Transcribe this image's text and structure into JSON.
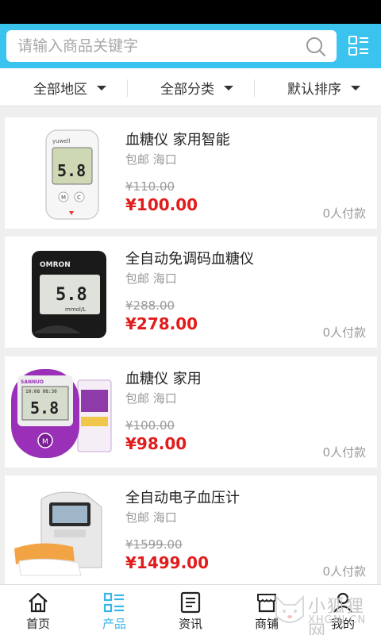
{
  "search": {
    "placeholder": "请输入商品关键字"
  },
  "filters": [
    {
      "label": "全部地区"
    },
    {
      "label": "全部分类"
    },
    {
      "label": "默认排序"
    }
  ],
  "products": [
    {
      "title": "血糖仪 家用智能",
      "shipping": "包邮 海口",
      "old_price": "¥110.00",
      "price": "¥100.00",
      "paid": "0人付款",
      "image": "glucose-meter-white"
    },
    {
      "title": "全自动免调码血糖仪",
      "shipping": "包邮 海口",
      "old_price": "¥288.00",
      "price": "¥278.00",
      "paid": "0人付款",
      "image": "glucose-meter-black-omron"
    },
    {
      "title": "血糖仪 家用",
      "shipping": "包邮 海口",
      "old_price": "¥100.00",
      "price": "¥98.00",
      "paid": "0人付款",
      "image": "glucose-meter-purple-kit"
    },
    {
      "title": "全自动电子血压计",
      "shipping": "包邮 海口",
      "old_price": "¥1599.00",
      "price": "¥1499.00",
      "paid": "0人付款",
      "image": "blood-pressure-monitor"
    }
  ],
  "meter_texts": {
    "brand_white": "yuwell",
    "brand_black": "OMRON",
    "brand_purple": "SANNUO",
    "reading": "5.8",
    "unit": "mmol/L",
    "clock": "10:08 08:30",
    "btn_m": "M",
    "btn_c": "C"
  },
  "tabs": [
    {
      "label": "首页",
      "icon": "home-icon",
      "active": false
    },
    {
      "label": "产品",
      "icon": "product-list-icon",
      "active": true
    },
    {
      "label": "资讯",
      "icon": "news-icon",
      "active": false
    },
    {
      "label": "商铺",
      "icon": "store-icon",
      "active": false
    },
    {
      "label": "我的",
      "icon": "user-icon",
      "active": false
    }
  ],
  "watermark": {
    "text": "小狐狸网",
    "sub": "XHGNI.CN"
  },
  "colors": {
    "accent": "#39c3ee",
    "price_red": "#e11c1c",
    "tab_active": "#39b6e8"
  }
}
